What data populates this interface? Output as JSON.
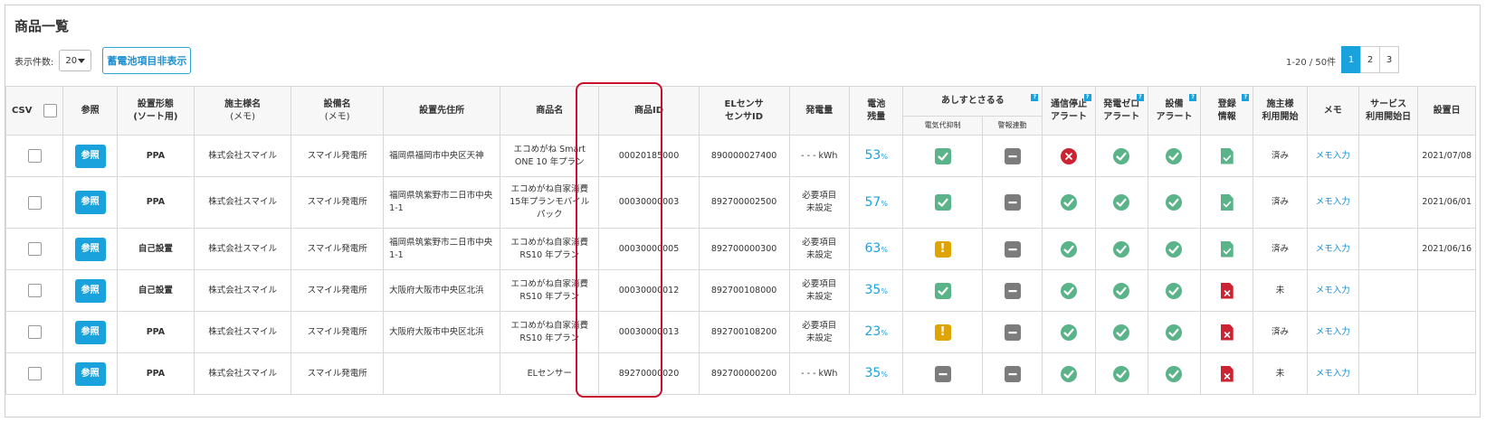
{
  "page": {
    "title": "商品一覧"
  },
  "toolbar": {
    "count_label": "表示件数:",
    "page_size": "20",
    "toggle_label": "蓄電池項目非表示"
  },
  "pagination": {
    "info": "1-20 / 50件",
    "pages": [
      "1",
      "2",
      "3"
    ],
    "active_page": "1"
  },
  "colors": {
    "accent": "#1aa2dc",
    "status_ok": "#5bb38a",
    "status_neutral": "#7c7c7c",
    "status_warning": "#e0a400",
    "status_error": "#cc2333",
    "highlight": "#c8102e"
  },
  "table": {
    "headers": {
      "csv": "CSV",
      "ref": "参照",
      "install_type_l1": "設置形態",
      "install_type_l2": "(ソート用)",
      "owner_l1": "施主様名",
      "owner_l2": "(メモ)",
      "equipment_l1": "設備名",
      "equipment_l2": "(メモ)",
      "address": "設置先住所",
      "product_name": "商品名",
      "product_id": "商品ID",
      "el_l1": "ELセンサ",
      "el_l2": "センサID",
      "generation": "発電量",
      "battery_l1": "電池",
      "battery_l2": "残量",
      "ashisuto": "あしすとさるる",
      "ashisuto_sub1": "電気代抑制",
      "ashisuto_sub2": "警報連動",
      "comm_l1": "通信停止",
      "comm_l2": "アラート",
      "zero_l1": "発電ゼロ",
      "zero_l2": "アラート",
      "equip_alert_l1": "設備",
      "equip_alert_l2": "アラート",
      "registration_l1": "登録",
      "registration_l2": "情報",
      "owner_start_l1": "施主様",
      "owner_start_l2": "利用開始",
      "memo": "メモ",
      "service_l1": "サービス",
      "service_l2": "利用開始日",
      "install_date": "設置日",
      "help_mark": "?"
    },
    "ref_label": "参照",
    "battery_unit": "%",
    "rows": [
      {
        "install_type": "PPA",
        "owner": "株式会社スマイル",
        "equipment": "スマイル発電所",
        "address": "福岡県福岡市中央区天神",
        "product_name": "エコめがね Smart ONE 10 年プラン",
        "product_id": "00020185000",
        "sensor_id": "890000027400",
        "generation": "- - - kWh",
        "battery": "53",
        "sup": "check",
        "alarm": "dash",
        "comm": "error",
        "zero": "ok",
        "equip": "ok",
        "reg": "ok",
        "owner_start": "済み",
        "memo": "メモ入力",
        "service_date": "",
        "install_date": "2021/07/08"
      },
      {
        "install_type": "PPA",
        "owner": "株式会社スマイル",
        "equipment": "スマイル発電所",
        "address": "福岡県筑紫野市二日市中央1-1",
        "product_name": "エコめがね自家消費15年プランモバイル パック",
        "product_id": "00030000003",
        "sensor_id": "892700002500",
        "generation": "必要項目未設定",
        "battery": "57",
        "sup": "check",
        "alarm": "dash",
        "comm": "ok",
        "zero": "ok",
        "equip": "ok",
        "reg": "ok",
        "owner_start": "済み",
        "memo": "メモ入力",
        "service_date": "",
        "install_date": "2021/06/01"
      },
      {
        "install_type": "自己設置",
        "owner": "株式会社スマイル",
        "equipment": "スマイル発電所",
        "address": "福岡県筑紫野市二日市中央1-1",
        "product_name": "エコめがね自家消費RS10 年プラン",
        "product_id": "00030000005",
        "sensor_id": "892700000300",
        "generation": "必要項目未設定",
        "battery": "63",
        "sup": "warn",
        "alarm": "dash",
        "comm": "ok",
        "zero": "ok",
        "equip": "ok",
        "reg": "ok",
        "owner_start": "済み",
        "memo": "メモ入力",
        "service_date": "",
        "install_date": "2021/06/16"
      },
      {
        "install_type": "自己設置",
        "owner": "株式会社スマイル",
        "equipment": "スマイル発電所",
        "address": "大阪府大阪市中央区北浜",
        "product_name": "エコめがね自家消費RS10 年プラン",
        "product_id": "00030000012",
        "sensor_id": "892700108000",
        "generation": "必要項目未設定",
        "battery": "35",
        "sup": "check",
        "alarm": "dash",
        "comm": "ok",
        "zero": "ok",
        "equip": "ok",
        "reg": "error",
        "owner_start": "未",
        "memo": "メモ入力",
        "service_date": "",
        "install_date": ""
      },
      {
        "install_type": "PPA",
        "owner": "株式会社スマイル",
        "equipment": "スマイル発電所",
        "address": "大阪府大阪市中央区北浜",
        "product_name": "エコめがね自家消費RS10 年プラン",
        "product_id": "00030000013",
        "sensor_id": "892700108200",
        "generation": "必要項目未設定",
        "battery": "23",
        "sup": "warn",
        "alarm": "dash",
        "comm": "ok",
        "zero": "ok",
        "equip": "ok",
        "reg": "error",
        "owner_start": "済み",
        "memo": "メモ入力",
        "service_date": "",
        "install_date": ""
      },
      {
        "install_type": "PPA",
        "owner": "株式会社スマイル",
        "equipment": "スマイル発電所",
        "address": "",
        "product_name": "ELセンサー",
        "product_id": "89270000020",
        "sensor_id": "892700000200",
        "generation": "- - - kWh",
        "battery": "35",
        "sup": "dash",
        "alarm": "dash",
        "comm": "ok",
        "zero": "ok",
        "equip": "ok",
        "reg": "error",
        "owner_start": "未",
        "memo": "メモ入力",
        "service_date": "",
        "install_date": ""
      }
    ]
  }
}
